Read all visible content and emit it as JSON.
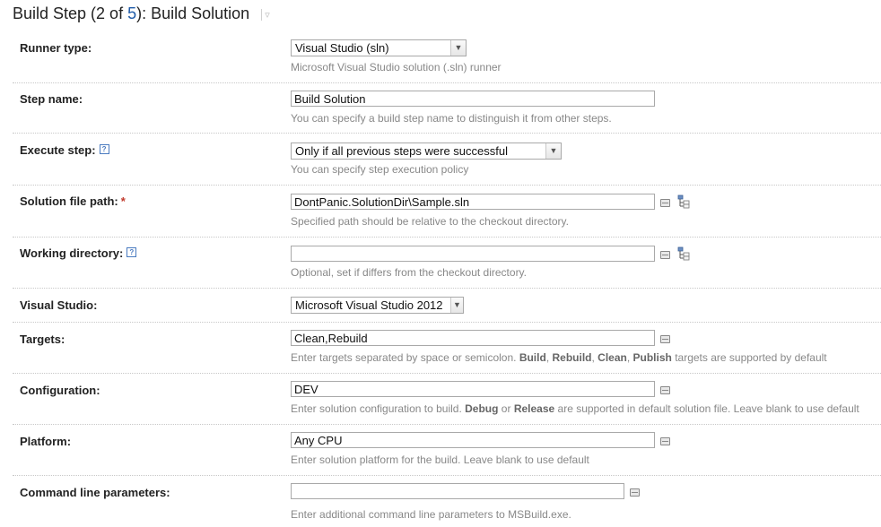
{
  "header": {
    "title_prefix": "Build Step (2 of ",
    "step_total": "5",
    "title_suffix": "): Build Solution"
  },
  "fields": {
    "runner_type": {
      "label": "Runner type:",
      "value": "Visual Studio (sln)",
      "hint": "Microsoft Visual Studio solution (.sln) runner"
    },
    "step_name": {
      "label": "Step name:",
      "value": "Build Solution",
      "hint": "You can specify a build step name to distinguish it from other steps."
    },
    "execute_step": {
      "label": "Execute step:",
      "value": "Only if all previous steps were successful",
      "hint": "You can specify step execution policy"
    },
    "solution_path": {
      "label": "Solution file path:",
      "required_mark": "*",
      "value": "DontPanic.SolutionDir\\Sample.sln",
      "hint": "Specified path should be relative to the checkout directory."
    },
    "working_directory": {
      "label": "Working directory:",
      "value": "",
      "hint": "Optional, set if differs from the checkout directory."
    },
    "visual_studio": {
      "label": "Visual Studio:",
      "value": "Microsoft Visual Studio 2012"
    },
    "targets": {
      "label": "Targets:",
      "value": "Clean,Rebuild",
      "hint_parts": [
        "Enter targets separated by space or semicolon. ",
        "Build",
        ", ",
        "Rebuild",
        ", ",
        "Clean",
        ", ",
        "Publish",
        " targets are supported by default"
      ]
    },
    "configuration": {
      "label": "Configuration:",
      "value": "DEV",
      "hint_parts": [
        "Enter solution configuration to build. ",
        "Debug",
        " or ",
        "Release",
        " are supported in default solution file. Leave blank to use default"
      ]
    },
    "platform": {
      "label": "Platform:",
      "value": "Any CPU",
      "hint": "Enter solution platform for the build. Leave blank to use default"
    },
    "command_line": {
      "label": "Command line parameters:",
      "value": "",
      "hint": "Enter additional command line parameters to MSBuild.exe."
    }
  },
  "icons": {
    "help": "help-icon",
    "expand": "expand-textbox-icon",
    "tree": "vcs-tree-browse-icon",
    "dropdown": "dropdown-arrow-icon"
  },
  "colors": {
    "link": "#1e5aa8",
    "required": "#c0392b",
    "hint_text": "#888888",
    "help_icon": "#4a7bc0"
  }
}
